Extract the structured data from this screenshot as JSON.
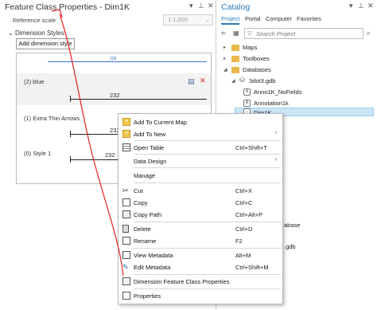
{
  "left_pane": {
    "title": "Feature Class Properties - Dim1K",
    "reference_scale_label": "Reference scale",
    "reference_scale_value": "1:1,000",
    "section_header": "Dimension Styles",
    "add_button_label": "Add dimension style",
    "styles": [
      {
        "label": "(2) blue",
        "value": "232"
      },
      {
        "label": "(1) Extra Thin Arrows",
        "value": "232"
      },
      {
        "label": "(0) Style 1",
        "value": "232"
      }
    ],
    "top_preview_value": "228"
  },
  "right_pane": {
    "title": "Catalog",
    "tabs": [
      "Project",
      "Portal",
      "Computer",
      "Favorites"
    ],
    "search_placeholder": "Search Project",
    "tree": [
      {
        "label": "Maps"
      },
      {
        "label": "Toolboxes"
      },
      {
        "label": "Databases"
      },
      {
        "label": "3dot3.gdb"
      },
      {
        "label": "Anno1K_NoFields"
      },
      {
        "label": "Annotation1k"
      },
      {
        "label": "Dim1K"
      }
    ],
    "partial_labels": [
      "abase",
      ".gdb"
    ]
  },
  "context_menu": {
    "items": [
      {
        "label": "Add To Current Map",
        "shortcut": "",
        "submenu": false,
        "icon": "add-to-map-icon"
      },
      {
        "label": "Add To New",
        "shortcut": "",
        "submenu": true,
        "icon": "add-to-new-icon"
      },
      {
        "label": "Open Table",
        "shortcut": "Ctrl+Shift+T",
        "submenu": false,
        "icon": "table-icon"
      },
      {
        "label": "Data Design",
        "shortcut": "",
        "submenu": true,
        "icon": ""
      },
      {
        "label": "Manage",
        "shortcut": "",
        "submenu": false,
        "icon": ""
      },
      {
        "label": "Cut",
        "shortcut": "Ctrl+X",
        "submenu": false,
        "icon": "scissors-icon"
      },
      {
        "label": "Copy",
        "shortcut": "Ctrl+C",
        "submenu": false,
        "icon": "copy-icon"
      },
      {
        "label": "Copy Path",
        "shortcut": "Ctrl+Alt+P",
        "submenu": false,
        "icon": "copy-path-icon"
      },
      {
        "label": "Delete",
        "shortcut": "Ctrl+D",
        "submenu": false,
        "icon": "delete-icon"
      },
      {
        "label": "Rename",
        "shortcut": "F2",
        "submenu": false,
        "icon": "rename-icon"
      },
      {
        "label": "View Metadata",
        "shortcut": "Alt+M",
        "submenu": false,
        "icon": "metadata-icon"
      },
      {
        "label": "Edit Metadata",
        "shortcut": "Ctrl+Shift+M",
        "submenu": false,
        "icon": "pencil-icon"
      },
      {
        "label": "Dimension Feature Class Properties",
        "shortcut": "",
        "submenu": false,
        "icon": "dim-properties-icon"
      },
      {
        "label": "Properties",
        "shortcut": "",
        "submenu": false,
        "icon": "properties-icon"
      }
    ]
  },
  "colors": {
    "accent": "#2b7bb9",
    "annotation_arrow": "#e02020",
    "selection": "#cce4f7"
  }
}
